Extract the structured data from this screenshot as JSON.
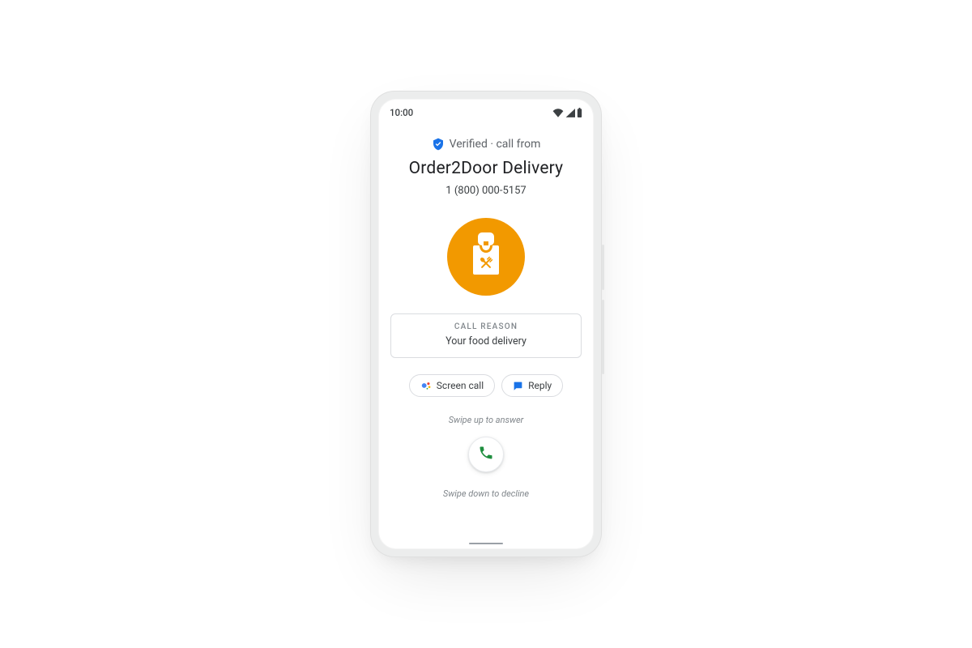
{
  "status": {
    "time": "10:00"
  },
  "verified": {
    "label": "Verified · call from"
  },
  "caller": {
    "name": "Order2Door Delivery",
    "number": "1 (800) 000-5157"
  },
  "reason": {
    "title": "CALL REASON",
    "body": "Your food delivery"
  },
  "actions": {
    "screen_call": "Screen call",
    "reply": "Reply"
  },
  "hints": {
    "up": "Swipe up to answer",
    "down": "Swipe down to decline"
  },
  "colors": {
    "avatar_bg": "#f29900",
    "verified_badge": "#1a73e8",
    "answer_green": "#1e8e3e",
    "reply_blue": "#1a73e8"
  }
}
